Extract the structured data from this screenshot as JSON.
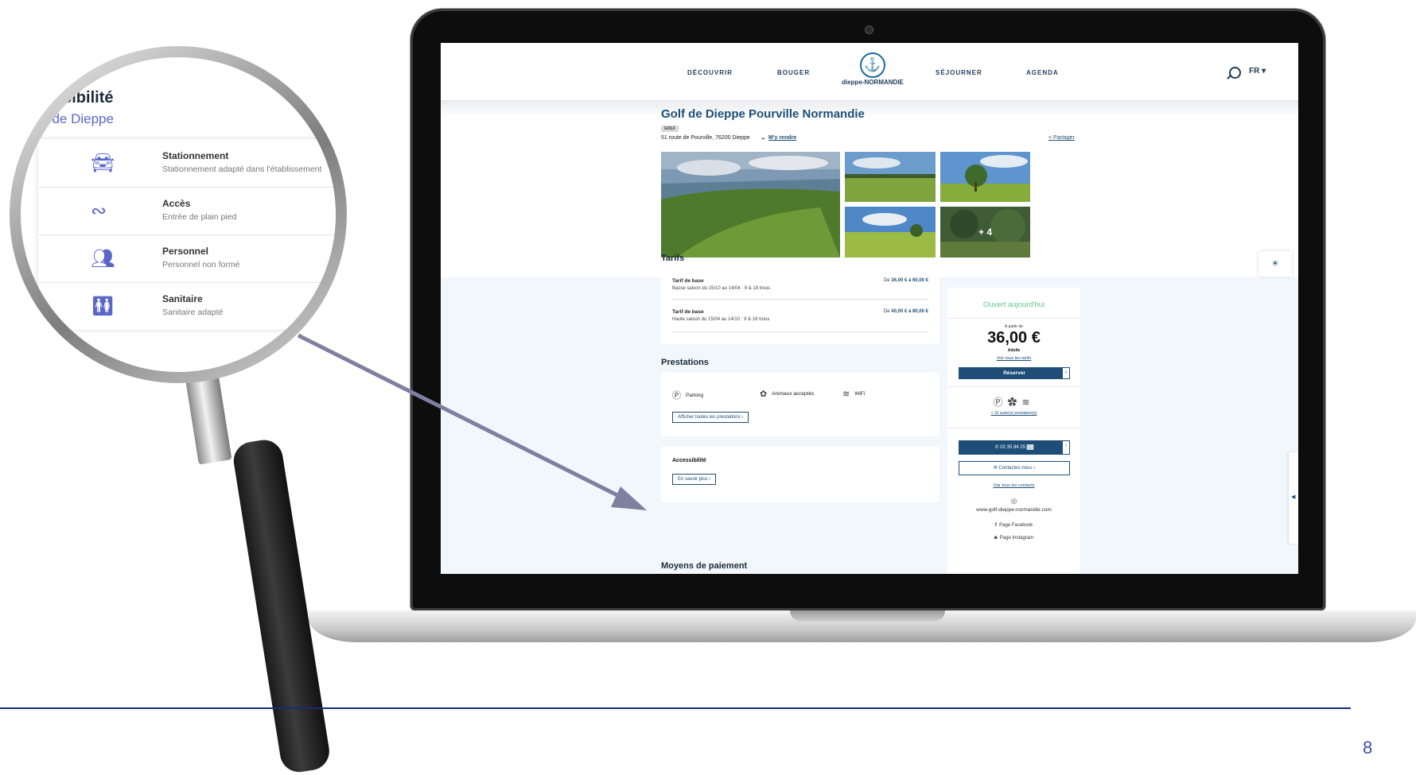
{
  "site": {
    "nav": [
      "DÉCOUVRIR",
      "BOUGER",
      "SÉJOURNER",
      "AGENDA"
    ],
    "logo_text": "dieppe-NORMANDIE",
    "lang": "FR ▾"
  },
  "listing": {
    "title": "Golf de Dieppe Pourville Normandie",
    "category": "GOLF",
    "address": "51 route de Pourville, 76200 Dieppe",
    "route_link": "M'y rendre",
    "share_link": "Partager",
    "more_photos": "+ 4"
  },
  "tarifs": {
    "heading": "Tarifs",
    "items": [
      {
        "label": "Tarif de base",
        "season": "Basse saison du 15/10 au 14/04 : 9 & 18 trous",
        "price_prefix": "De ",
        "price": "36,00 € à 60,00 €"
      },
      {
        "label": "Tarif de base",
        "season": "Haute saison du 15/04 au 14/10 : 9 & 18 trous",
        "price_prefix": "De ",
        "price": "40,00 € à 80,00 €"
      }
    ]
  },
  "prestations": {
    "heading": "Prestations",
    "items": [
      "Parking",
      "Animaux acceptés",
      "WiFi"
    ],
    "show_all": "Afficher toutes les prestations"
  },
  "accessibilite": {
    "title": "Accessibilité",
    "more": "En savoir plus"
  },
  "paiement": {
    "heading": "Moyens de paiement"
  },
  "sidebar": {
    "open_today": "Ouvert aujourd'hui",
    "from": "À partir de",
    "price": "36,00 €",
    "price_unit": "Adulte",
    "all_tarifs": "Voir tous les tarifs",
    "book": "Réserver",
    "other_presta": "+ 32 autre(s) prestation(s)",
    "phone": "02 35 84 25",
    "contact": "Contactez-nous",
    "all_contacts": "Voir tous les contacts",
    "website": "www.golf-dieppe-normandie.com",
    "facebook": "Page Facebook",
    "instagram": "Page Instagram"
  },
  "zoom": {
    "title": "ssibilité",
    "subtitle": "f de Dieppe",
    "items": [
      {
        "label": "Stationnement",
        "desc": "Stationnement adapté dans l'établissement",
        "icon": "car-icon"
      },
      {
        "label": "Accès",
        "desc": "Entrée de plain pied",
        "icon": "path-icon"
      },
      {
        "label": "Personnel",
        "desc": "Personnel non formé",
        "icon": "people-icon"
      },
      {
        "label": "Sanitaire",
        "desc": "Sanitaire adapté",
        "icon": "restroom-icon"
      }
    ]
  },
  "page_number": "8",
  "colors": {
    "brand": "#1e4e78",
    "accent": "#5a67c8",
    "open": "#5cc98a",
    "footer_line": "#1b2a7a"
  }
}
